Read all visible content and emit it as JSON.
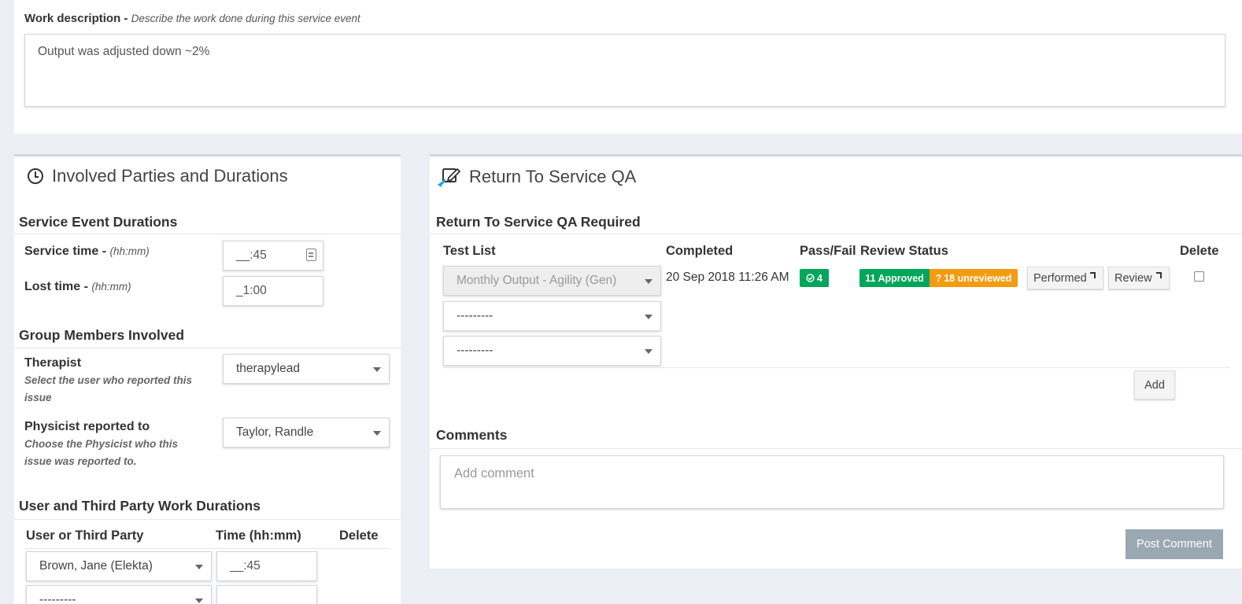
{
  "work": {
    "label": "Work description",
    "separator": " - ",
    "hint": "Describe the work done during this service event",
    "value": "Output was adjusted down ~2%"
  },
  "parties": {
    "title": "Involved Parties and Durations",
    "title_icon": "clock-icon",
    "durations_heading": "Service Event Durations",
    "service_time_label": "Service time",
    "lost_time_label": "Lost time",
    "label_sep": " - ",
    "time_hint": "(hh:mm)",
    "service_time_value": "__:45",
    "lost_time_value": "_1:00",
    "group_heading": "Group Members Involved",
    "therapist_label": "Therapist",
    "therapist_help": "Select the user who reported this issue",
    "therapist_value": "therapylead",
    "physicist_label": "Physicist reported to",
    "physicist_help": "Choose the Physicist who this issue was reported to.",
    "physicist_value": "Taylor, Randle",
    "third_heading": "User and Third Party Work Durations",
    "col_user": "User or Third Party",
    "col_time": "Time (hh:mm)",
    "col_delete": "Delete",
    "rows": [
      {
        "user": "Brown, Jane (Elekta)",
        "time": "__:45"
      },
      {
        "user": "---------",
        "time": ""
      }
    ]
  },
  "rtsqa": {
    "title": "Return To Service QA",
    "title_icon": "edit-return-icon",
    "heading": "Return To Service QA Required",
    "col_test_list": "Test List",
    "col_completed": "Completed",
    "col_pass_fail": "Pass/Fail",
    "col_review": "Review Status",
    "col_delete": "Delete",
    "row": {
      "test_list": "Monthly Output - Agility (Gen)",
      "completed": "20 Sep 2018 11:26 AM",
      "pass_count": "4",
      "approved": "11 Approved",
      "unreviewed": "18 unreviewed",
      "unreviewed_icon": "?",
      "performed_btn": "Performed",
      "review_btn": "Review"
    },
    "empty_selects": [
      "---------",
      "---------"
    ],
    "add_btn": "Add",
    "comments_heading": "Comments",
    "comment_placeholder": "Add comment",
    "post_btn": "Post Comment",
    "colors": {
      "approved": "#00a65a",
      "unreviewed": "#f39c12",
      "pass": "#00a65a"
    }
  }
}
